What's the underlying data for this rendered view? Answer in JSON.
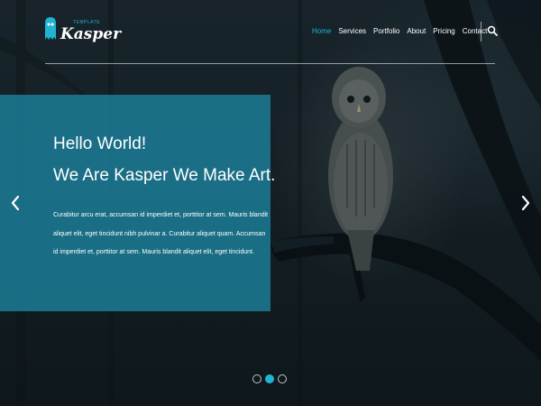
{
  "brand": {
    "name": "Kasper",
    "tagline": "TEMPLATE",
    "ghost_icon": "ghost-icon",
    "accent_color": "#1fb4d3"
  },
  "nav": {
    "items": [
      {
        "label": "Home",
        "active": true
      },
      {
        "label": "Services",
        "active": false
      },
      {
        "label": "Portfolio",
        "active": false
      },
      {
        "label": "About",
        "active": false
      },
      {
        "label": "Pricing",
        "active": false
      },
      {
        "label": "Contact",
        "active": false
      }
    ],
    "search_icon": "search-icon"
  },
  "slide": {
    "title": "Hello World!",
    "subtitle": "We Are Kasper We Make Art.",
    "description": "Curabitur arcu erat, accumsan id imperdiet et, porttitor at sem. Mauris blandit aliquet elit, eget tincidunt nibh pulvinar a. Curabitur aliquet quam. Accumsan id imperdiet et, porttitor at sem. Mauris blandit aliquet elit, eget tincidunt.",
    "box_color": "#1b7d96",
    "background_image": "owl perched on a tree branch in a dark forest"
  },
  "controls": {
    "prev_icon": "chevron-left-icon",
    "next_icon": "chevron-right-icon",
    "bullets": [
      {
        "active": false
      },
      {
        "active": true
      },
      {
        "active": false
      }
    ]
  }
}
